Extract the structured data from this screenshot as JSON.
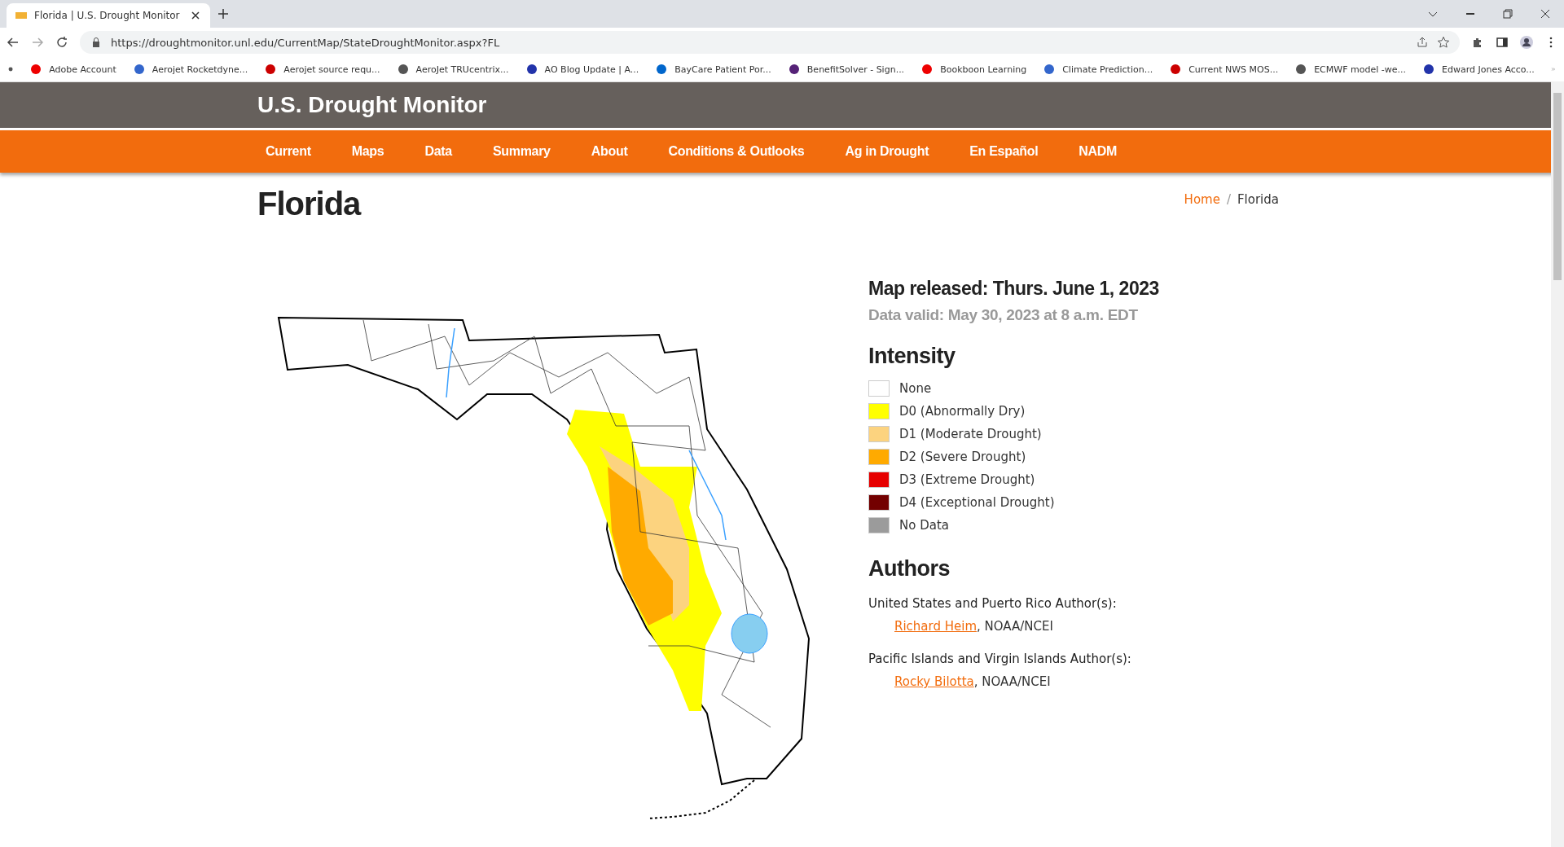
{
  "browser": {
    "tab_title": "Florida | U.S. Drought Monitor",
    "url": "https://droughtmonitor.unl.edu/CurrentMap/StateDroughtMonitor.aspx?FL",
    "bookmarks": [
      "Adobe Account",
      "Aerojet Rocketdyne...",
      "Aerojet source requ...",
      "AeroJet TRUcentrix...",
      "AO Blog Update | A...",
      "BayCare Patient Por...",
      "BenefitSolver - Sign...",
      "Bookboon Learning",
      "Climate Prediction...",
      "Current NWS MOS...",
      "ECMWF model -we...",
      "Edward Jones Acco..."
    ]
  },
  "site": {
    "title": "U.S. Drought Monitor",
    "nav": [
      {
        "label": "Current"
      },
      {
        "label": "Maps"
      },
      {
        "label": "Data"
      },
      {
        "label": "Summary"
      },
      {
        "label": "About"
      },
      {
        "label": "Conditions & Outlooks"
      },
      {
        "label": "Ag in Drought"
      },
      {
        "label": "En Español"
      },
      {
        "label": "NADM"
      }
    ]
  },
  "page": {
    "heading": "Florida",
    "breadcrumb": {
      "items": [
        "Home",
        "Florida"
      ],
      "separator": "/"
    }
  },
  "map_info": {
    "released": "Map released: Thurs. June 1, 2023",
    "valid": "Data valid: May 30, 2023 at 8 a.m. EDT"
  },
  "intensity": {
    "heading": "Intensity",
    "items": [
      {
        "label": "None",
        "color": "#ffffff"
      },
      {
        "label": "D0 (Abnormally Dry)",
        "color": "#ffff00"
      },
      {
        "label": "D1 (Moderate Drought)",
        "color": "#fcd37f"
      },
      {
        "label": "D2 (Severe Drought)",
        "color": "#ffaa00"
      },
      {
        "label": "D3 (Extreme Drought)",
        "color": "#e60000"
      },
      {
        "label": "D4 (Exceptional Drought)",
        "color": "#730000"
      },
      {
        "label": "No Data",
        "color": "#9b9b9b"
      }
    ]
  },
  "authors": {
    "heading": "Authors",
    "groups": [
      {
        "title": "United States and Puerto Rico Author(s):",
        "name": "Richard Heim",
        "org": ", NOAA/NCEI"
      },
      {
        "title": "Pacific Islands and Virgin Islands Author(s):",
        "name": "Rocky Bilotta",
        "org": ", NOAA/NCEI"
      }
    ]
  }
}
